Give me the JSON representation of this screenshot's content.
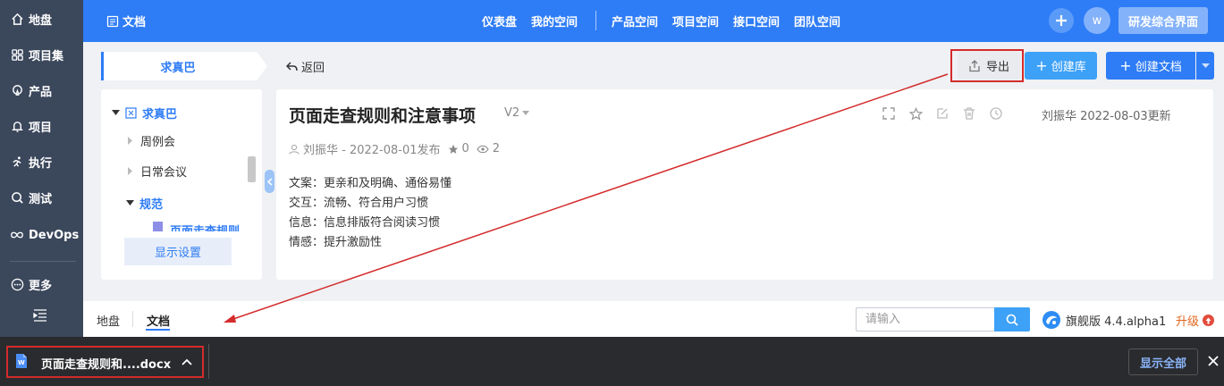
{
  "sidebar": {
    "items": [
      {
        "label": "地盘",
        "icon": "home-icon"
      },
      {
        "label": "项目集",
        "icon": "grid-icon"
      },
      {
        "label": "产品",
        "icon": "lightbulb-icon"
      },
      {
        "label": "项目",
        "icon": "bell-icon"
      },
      {
        "label": "执行",
        "icon": "run-icon"
      },
      {
        "label": "测试",
        "icon": "search-icon"
      },
      {
        "label": "DevOps",
        "icon": "infinity-icon"
      }
    ],
    "more_label": "更多"
  },
  "topbar": {
    "title": "文档",
    "nav": [
      "仪表盘",
      "我的空间",
      "产品空间",
      "项目空间",
      "接口空间",
      "团队空间"
    ],
    "avatar_letter": "w",
    "system_button": "研发综合界面"
  },
  "toolbar": {
    "library_name": "求真巴",
    "back_label": "返回",
    "export_label": "导出",
    "create_lib_label": "创建库",
    "create_doc_label": "创建文档"
  },
  "tree": {
    "root": "求真巴",
    "children": [
      "周例会",
      "日常会议",
      "规范"
    ],
    "leaf": "页面走查规则",
    "display_settings": "显示设置"
  },
  "doc": {
    "title": "页面走查规则和注意事项",
    "version": "V2",
    "updated": "刘振华 2022-08-03更新",
    "author_published": "刘振华 - 2022-08-01发布",
    "stars": "0",
    "views": "2",
    "lines": [
      "文案：更亲和及明确、通俗易懂",
      "交互：流畅、符合用户习惯",
      "信息：信息排版符合阅读习惯",
      "情感：提升激励性"
    ]
  },
  "bottom": {
    "tabs": [
      "地盘",
      "文档"
    ],
    "search_placeholder": "请输入",
    "edition": "旗舰版 4.4.alpha1",
    "upgrade": "升级"
  },
  "download": {
    "file_name": "页面走查规则和....docx",
    "show_all": "显示全部"
  },
  "colors": {
    "brand_blue": "#2e7cf6",
    "sidebar": "#3b475b",
    "annotation_red": "#d42b2b"
  }
}
